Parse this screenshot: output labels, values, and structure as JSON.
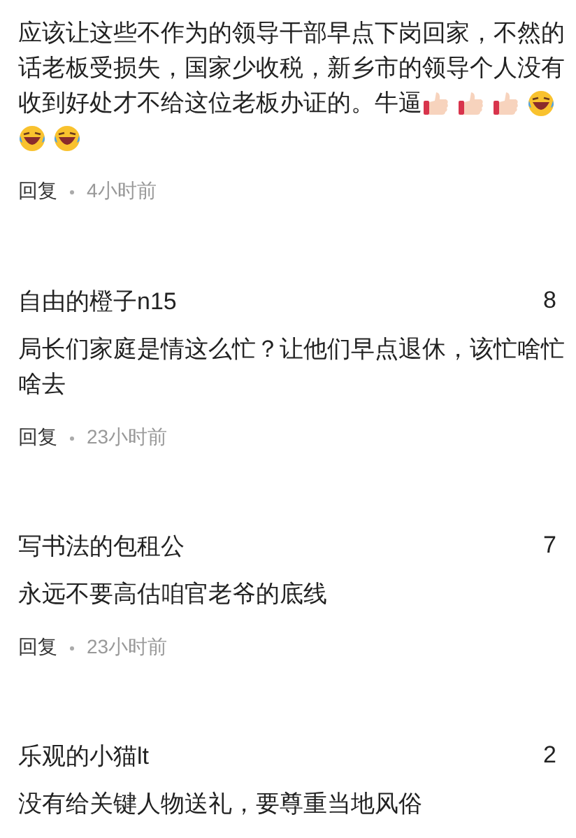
{
  "comments": [
    {
      "lines": [
        {
          "text": "应该让这些不作为的领导干部早点下岗回家，不然的"
        },
        {
          "text": "话老板受损失，国家少收税，新乡市的领导个人没有"
        },
        {
          "text": "收到好处才不给这位老板办证的。牛逼",
          "emojis": [
            {
              "kind": "thumbs"
            },
            {
              "kind": "thumbs"
            },
            {
              "kind": "thumbs"
            },
            {
              "kind": "laugh"
            }
          ]
        },
        {
          "emojis": [
            {
              "kind": "laugh"
            },
            {
              "kind": "laugh"
            }
          ]
        }
      ],
      "reply": "回复",
      "time": "4小时前"
    },
    {
      "author": "自由的橙子n15",
      "count": "8",
      "lines": [
        {
          "text": "局长们家庭是情这么忙？让他们早点退休，该忙啥忙"
        },
        {
          "text": "啥去"
        }
      ],
      "reply": "回复",
      "time": "23小时前"
    },
    {
      "author": "写书法的包租公",
      "count": "7",
      "lines": [
        {
          "text": "永远不要高估咱官老爷的底线"
        }
      ],
      "reply": "回复",
      "time": "23小时前"
    },
    {
      "author": "乐观的小猫lt",
      "count": "2",
      "lines": [
        {
          "text": "没有给关键人物送礼，要尊重当地风俗"
        }
      ]
    }
  ]
}
